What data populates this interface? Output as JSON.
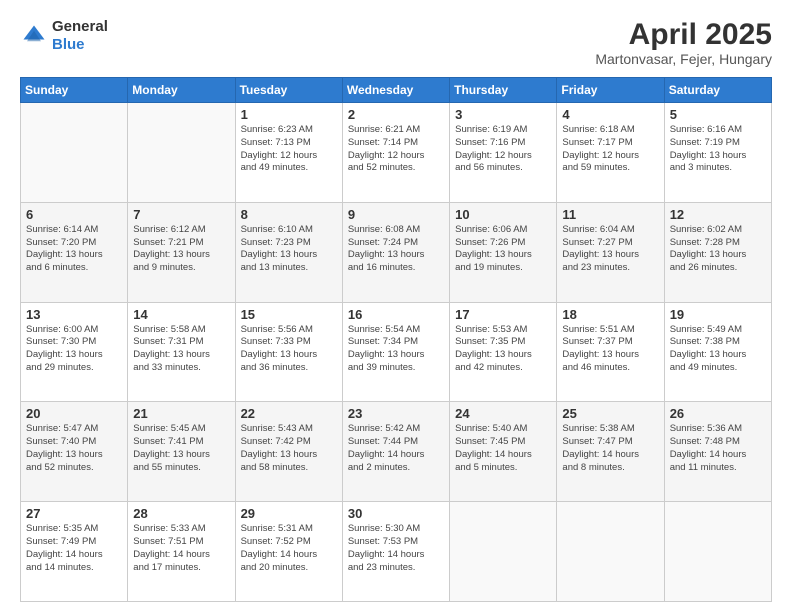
{
  "header": {
    "logo_line1": "General",
    "logo_line2": "Blue",
    "main_title": "April 2025",
    "subtitle": "Martonvasar, Fejer, Hungary"
  },
  "days_of_week": [
    "Sunday",
    "Monday",
    "Tuesday",
    "Wednesday",
    "Thursday",
    "Friday",
    "Saturday"
  ],
  "weeks": [
    {
      "shade": false,
      "days": [
        {
          "date": "",
          "info": ""
        },
        {
          "date": "",
          "info": ""
        },
        {
          "date": "1",
          "info": "Sunrise: 6:23 AM\nSunset: 7:13 PM\nDaylight: 12 hours\nand 49 minutes."
        },
        {
          "date": "2",
          "info": "Sunrise: 6:21 AM\nSunset: 7:14 PM\nDaylight: 12 hours\nand 52 minutes."
        },
        {
          "date": "3",
          "info": "Sunrise: 6:19 AM\nSunset: 7:16 PM\nDaylight: 12 hours\nand 56 minutes."
        },
        {
          "date": "4",
          "info": "Sunrise: 6:18 AM\nSunset: 7:17 PM\nDaylight: 12 hours\nand 59 minutes."
        },
        {
          "date": "5",
          "info": "Sunrise: 6:16 AM\nSunset: 7:19 PM\nDaylight: 13 hours\nand 3 minutes."
        }
      ]
    },
    {
      "shade": true,
      "days": [
        {
          "date": "6",
          "info": "Sunrise: 6:14 AM\nSunset: 7:20 PM\nDaylight: 13 hours\nand 6 minutes."
        },
        {
          "date": "7",
          "info": "Sunrise: 6:12 AM\nSunset: 7:21 PM\nDaylight: 13 hours\nand 9 minutes."
        },
        {
          "date": "8",
          "info": "Sunrise: 6:10 AM\nSunset: 7:23 PM\nDaylight: 13 hours\nand 13 minutes."
        },
        {
          "date": "9",
          "info": "Sunrise: 6:08 AM\nSunset: 7:24 PM\nDaylight: 13 hours\nand 16 minutes."
        },
        {
          "date": "10",
          "info": "Sunrise: 6:06 AM\nSunset: 7:26 PM\nDaylight: 13 hours\nand 19 minutes."
        },
        {
          "date": "11",
          "info": "Sunrise: 6:04 AM\nSunset: 7:27 PM\nDaylight: 13 hours\nand 23 minutes."
        },
        {
          "date": "12",
          "info": "Sunrise: 6:02 AM\nSunset: 7:28 PM\nDaylight: 13 hours\nand 26 minutes."
        }
      ]
    },
    {
      "shade": false,
      "days": [
        {
          "date": "13",
          "info": "Sunrise: 6:00 AM\nSunset: 7:30 PM\nDaylight: 13 hours\nand 29 minutes."
        },
        {
          "date": "14",
          "info": "Sunrise: 5:58 AM\nSunset: 7:31 PM\nDaylight: 13 hours\nand 33 minutes."
        },
        {
          "date": "15",
          "info": "Sunrise: 5:56 AM\nSunset: 7:33 PM\nDaylight: 13 hours\nand 36 minutes."
        },
        {
          "date": "16",
          "info": "Sunrise: 5:54 AM\nSunset: 7:34 PM\nDaylight: 13 hours\nand 39 minutes."
        },
        {
          "date": "17",
          "info": "Sunrise: 5:53 AM\nSunset: 7:35 PM\nDaylight: 13 hours\nand 42 minutes."
        },
        {
          "date": "18",
          "info": "Sunrise: 5:51 AM\nSunset: 7:37 PM\nDaylight: 13 hours\nand 46 minutes."
        },
        {
          "date": "19",
          "info": "Sunrise: 5:49 AM\nSunset: 7:38 PM\nDaylight: 13 hours\nand 49 minutes."
        }
      ]
    },
    {
      "shade": true,
      "days": [
        {
          "date": "20",
          "info": "Sunrise: 5:47 AM\nSunset: 7:40 PM\nDaylight: 13 hours\nand 52 minutes."
        },
        {
          "date": "21",
          "info": "Sunrise: 5:45 AM\nSunset: 7:41 PM\nDaylight: 13 hours\nand 55 minutes."
        },
        {
          "date": "22",
          "info": "Sunrise: 5:43 AM\nSunset: 7:42 PM\nDaylight: 13 hours\nand 58 minutes."
        },
        {
          "date": "23",
          "info": "Sunrise: 5:42 AM\nSunset: 7:44 PM\nDaylight: 14 hours\nand 2 minutes."
        },
        {
          "date": "24",
          "info": "Sunrise: 5:40 AM\nSunset: 7:45 PM\nDaylight: 14 hours\nand 5 minutes."
        },
        {
          "date": "25",
          "info": "Sunrise: 5:38 AM\nSunset: 7:47 PM\nDaylight: 14 hours\nand 8 minutes."
        },
        {
          "date": "26",
          "info": "Sunrise: 5:36 AM\nSunset: 7:48 PM\nDaylight: 14 hours\nand 11 minutes."
        }
      ]
    },
    {
      "shade": false,
      "days": [
        {
          "date": "27",
          "info": "Sunrise: 5:35 AM\nSunset: 7:49 PM\nDaylight: 14 hours\nand 14 minutes."
        },
        {
          "date": "28",
          "info": "Sunrise: 5:33 AM\nSunset: 7:51 PM\nDaylight: 14 hours\nand 17 minutes."
        },
        {
          "date": "29",
          "info": "Sunrise: 5:31 AM\nSunset: 7:52 PM\nDaylight: 14 hours\nand 20 minutes."
        },
        {
          "date": "30",
          "info": "Sunrise: 5:30 AM\nSunset: 7:53 PM\nDaylight: 14 hours\nand 23 minutes."
        },
        {
          "date": "",
          "info": ""
        },
        {
          "date": "",
          "info": ""
        },
        {
          "date": "",
          "info": ""
        }
      ]
    }
  ]
}
